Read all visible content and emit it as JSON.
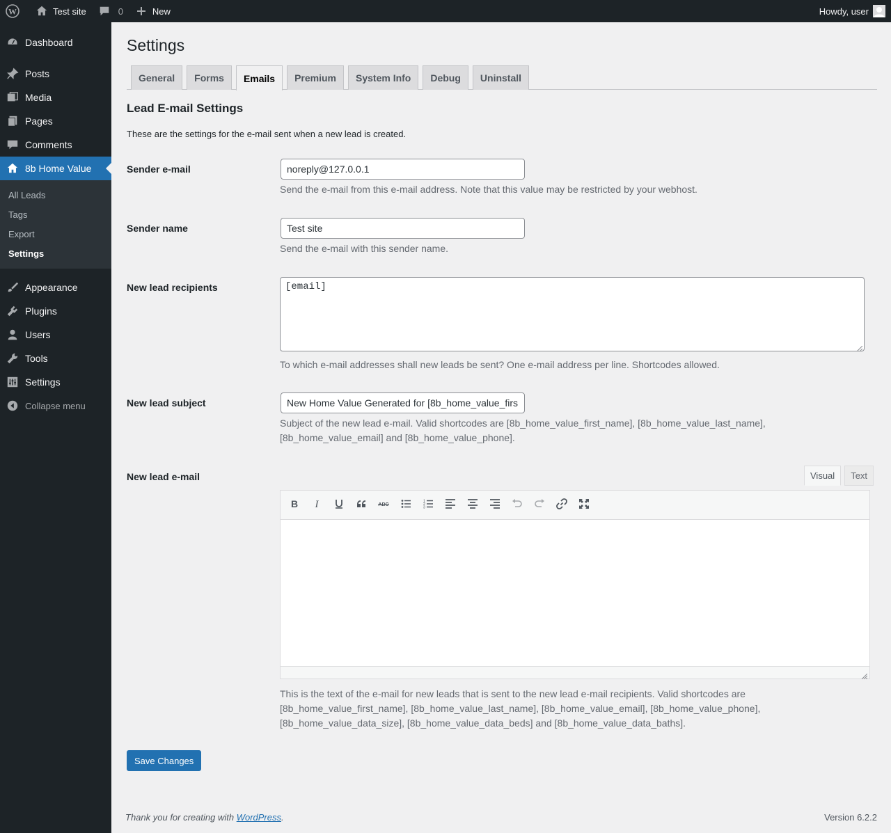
{
  "adminbar": {
    "site_name": "Test site",
    "comments_count": "0",
    "new_label": "New",
    "howdy": "Howdy, user"
  },
  "sidebar": {
    "items": [
      {
        "label": "Dashboard",
        "icon": "dashboard-icon"
      },
      {
        "label": "Posts",
        "icon": "pin-icon"
      },
      {
        "label": "Media",
        "icon": "media-icon"
      },
      {
        "label": "Pages",
        "icon": "pages-icon"
      },
      {
        "label": "Comments",
        "icon": "comments-icon"
      },
      {
        "label": "8b Home Value",
        "icon": "home-icon"
      },
      {
        "label": "Appearance",
        "icon": "brush-icon"
      },
      {
        "label": "Plugins",
        "icon": "plugin-icon"
      },
      {
        "label": "Users",
        "icon": "user-icon"
      },
      {
        "label": "Tools",
        "icon": "wrench-icon"
      },
      {
        "label": "Settings",
        "icon": "settings-icon"
      }
    ],
    "submenu": [
      "All Leads",
      "Tags",
      "Export",
      "Settings"
    ],
    "collapse_label": "Collapse menu"
  },
  "page": {
    "title": "Settings",
    "tabs": [
      "General",
      "Forms",
      "Emails",
      "Premium",
      "System Info",
      "Debug",
      "Uninstall"
    ],
    "active_tab": "Emails",
    "section_title": "Lead E-mail Settings",
    "intro": "These are the settings for the e-mail sent when a new lead is created."
  },
  "fields": {
    "sender_email": {
      "label": "Sender e-mail",
      "value": "noreply@127.0.0.1",
      "description": "Send the e-mail from this e-mail address. Note that this value may be restricted by your webhost."
    },
    "sender_name": {
      "label": "Sender name",
      "value": "Test site",
      "description": "Send the e-mail with this sender name."
    },
    "recipients": {
      "label": "New lead recipients",
      "value": "[email]",
      "description": "To which e-mail addresses shall new leads be sent? One e-mail address per line. Shortcodes allowed."
    },
    "subject": {
      "label": "New lead subject",
      "value": "New Home Value Generated for [8b_home_value_firs",
      "description_line1": "Subject of the new lead e-mail. Valid shortcodes are [8b_home_value_first_name], [8b_home_value_last_name],",
      "description_line2": "[8b_home_value_email] and [8b_home_value_phone]."
    },
    "email_body": {
      "label": "New lead e-mail",
      "visual_tab": "Visual",
      "text_tab": "Text",
      "description_line1": "This is the text of the e-mail for new leads that is sent to the new lead e-mail recipients. Valid shortcodes are",
      "description_line2": "[8b_home_value_first_name], [8b_home_value_last_name], [8b_home_value_email], [8b_home_value_phone],",
      "description_line3": "[8b_home_value_data_size], [8b_home_value_data_beds] and [8b_home_value_data_baths]."
    }
  },
  "save_label": "Save Changes",
  "footer": {
    "thanks_prefix": "Thank you for creating with ",
    "wp_link": "WordPress",
    "thanks_suffix": ".",
    "version": "Version 6.2.2"
  },
  "colors": {
    "accent": "#2271b1",
    "admin_bg": "#1d2327"
  }
}
